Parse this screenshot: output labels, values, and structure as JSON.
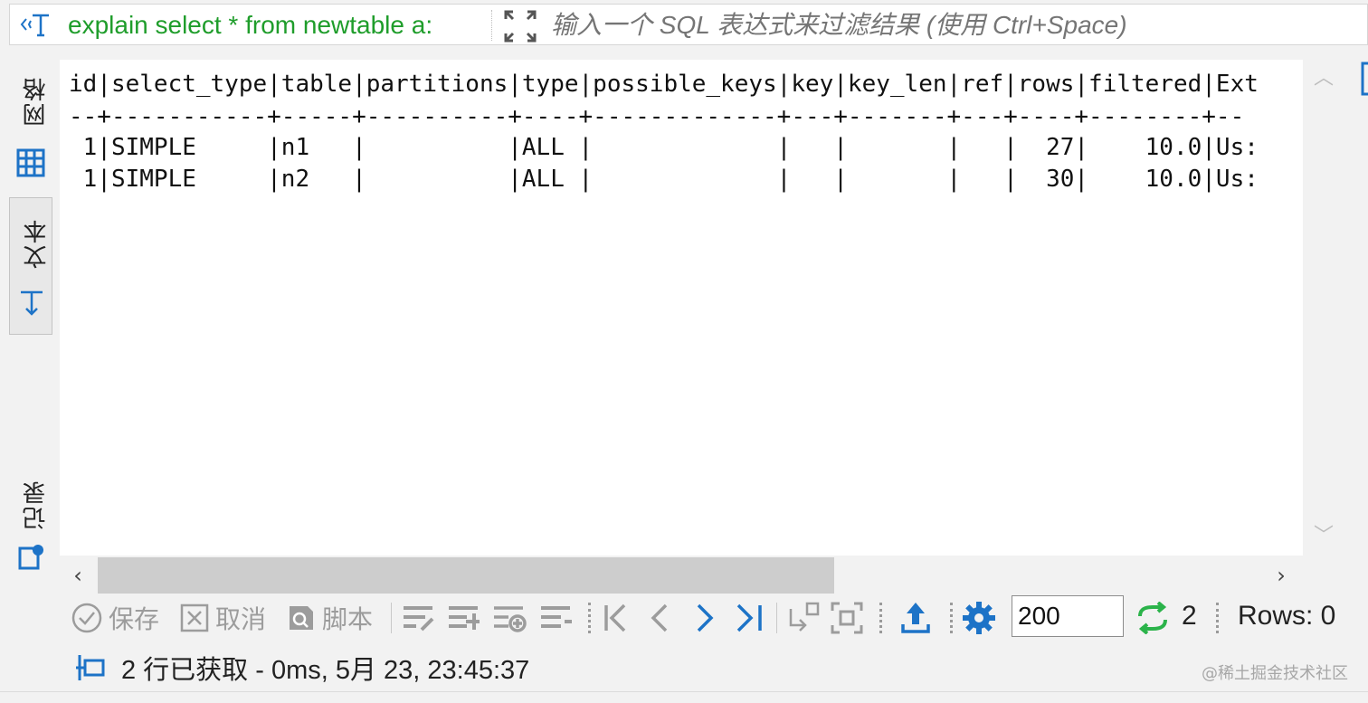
{
  "query_bar": {
    "sql_text": "explain select * from newtable a:",
    "filter_placeholder": "输入一个 SQL 表达式来过滤结果 (使用 Ctrl+Space)",
    "filter_value": ""
  },
  "side_tabs": [
    {
      "label": "网格",
      "icon": "grid-icon"
    },
    {
      "label": "文本",
      "icon": "text-mode-icon",
      "active": true
    },
    {
      "label": "记录",
      "icon": "record-icon"
    }
  ],
  "result_text": {
    "lines": [
      "id|select_type|table|partitions|type|possible_keys|key|key_len|ref|rows|filtered|Ext",
      "--+-----------+-----+----------+----+-------------+---+-------+---+----+--------+--",
      " 1|SIMPLE     |n1   |          |ALL |             |   |       |   |  27|    10.0|Us:",
      " 1|SIMPLE     |n2   |          |ALL |             |   |       |   |  30|    10.0|Us:"
    ]
  },
  "toolbar": {
    "save_label": "保存",
    "cancel_label": "取消",
    "script_label": "脚本",
    "fetch_size": "200",
    "refresh_count": "2",
    "rows_label": "Rows: 0"
  },
  "status": {
    "text": "2 行已获取 - 0ms, 5月 23, 23:45:37"
  },
  "watermark": "@稀土掘金技术社区",
  "colors": {
    "sql_green": "#1f9d2b",
    "accent_blue": "#1d73c7",
    "refresh_green": "#2bb34a",
    "disabled_gray": "#9c9c9c"
  }
}
